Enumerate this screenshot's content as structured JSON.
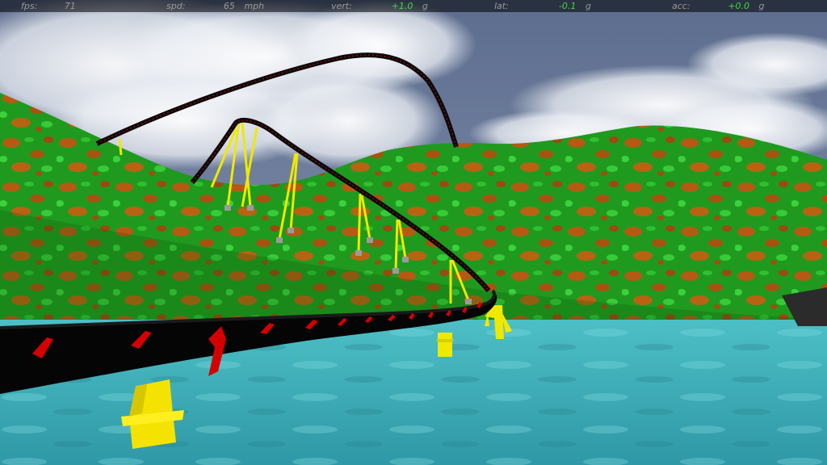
{
  "hud": {
    "fps": {
      "label": "fps:",
      "value": "71"
    },
    "spd": {
      "label": "spd:",
      "value": "65",
      "unit": "mph"
    },
    "vert": {
      "label": "vert:",
      "value": "+1.0",
      "unit": "g"
    },
    "lat": {
      "label": "lat:",
      "value": "-0.1",
      "unit": "g"
    },
    "acc": {
      "label": "acc:",
      "value": "+0.0",
      "unit": "g"
    }
  },
  "colors": {
    "hud_text": "#9a9a9a",
    "hud_value_highlight": "#3cdc3c",
    "sky": "#6f7f9c",
    "water": "#3aa9b3",
    "terrain_green": "#1e9a1e",
    "terrain_brown": "#b85a10",
    "track_rail": "#0a0a0a",
    "track_tie": "#d40000",
    "support": "#f0e800"
  }
}
